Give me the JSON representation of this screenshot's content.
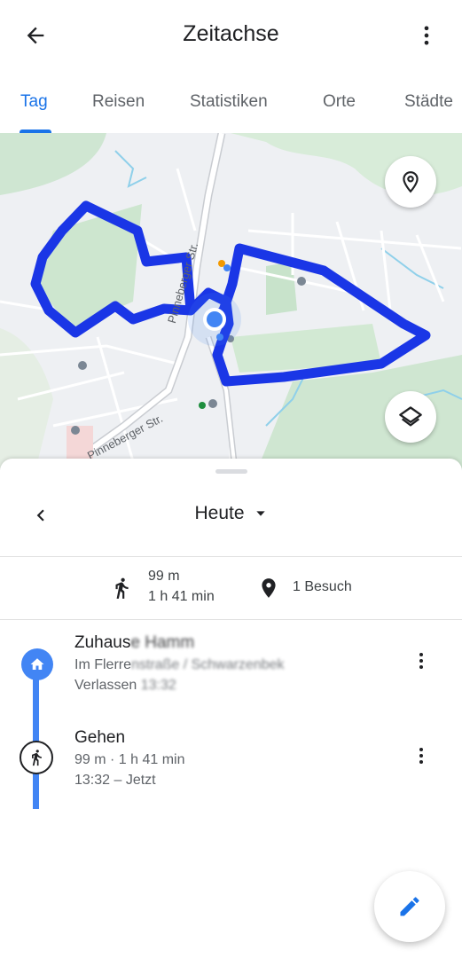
{
  "app_bar": {
    "title": "Zeitachse",
    "back_icon": "arrow-back-icon",
    "more_icon": "more-vert-icon"
  },
  "tabs": [
    {
      "label": "Tag",
      "active": true
    },
    {
      "label": "Reisen",
      "active": false
    },
    {
      "label": "Statistiken",
      "active": false
    },
    {
      "label": "Orte",
      "active": false
    },
    {
      "label": "Städte",
      "active": false
    }
  ],
  "map": {
    "road_labels": [
      "Pinneberger Str.",
      "Pinneberger Str."
    ],
    "route_color": "#1a36e6",
    "location_icon": "place-marker-icon",
    "layers_icon": "layers-icon"
  },
  "day_nav": {
    "label": "Heute",
    "prev_icon": "chevron-left-icon",
    "dropdown_icon": "caret-down-icon"
  },
  "summary": {
    "walk_distance": "99 m",
    "walk_duration": "1 h 41 min",
    "visits": "1 Besuch"
  },
  "timeline": [
    {
      "icon": "home-icon",
      "title": "Zuhaus",
      "title_obscured": "e Hamm",
      "line2": "Im Flerre",
      "line2_obscured": "nstraße / Schwarzenbek",
      "line3": "Verlassen",
      "line3_obscured": " 13:32"
    },
    {
      "icon": "walking-icon",
      "title": "Gehen",
      "line2": "99 m · 1 h 41 min",
      "line3": "13:32 – Jetzt"
    }
  ],
  "fab_icon": "edit-pencil-icon",
  "colors": {
    "accent": "#1a73e8",
    "timeline": "#4285f4",
    "route": "#1a36e6"
  }
}
